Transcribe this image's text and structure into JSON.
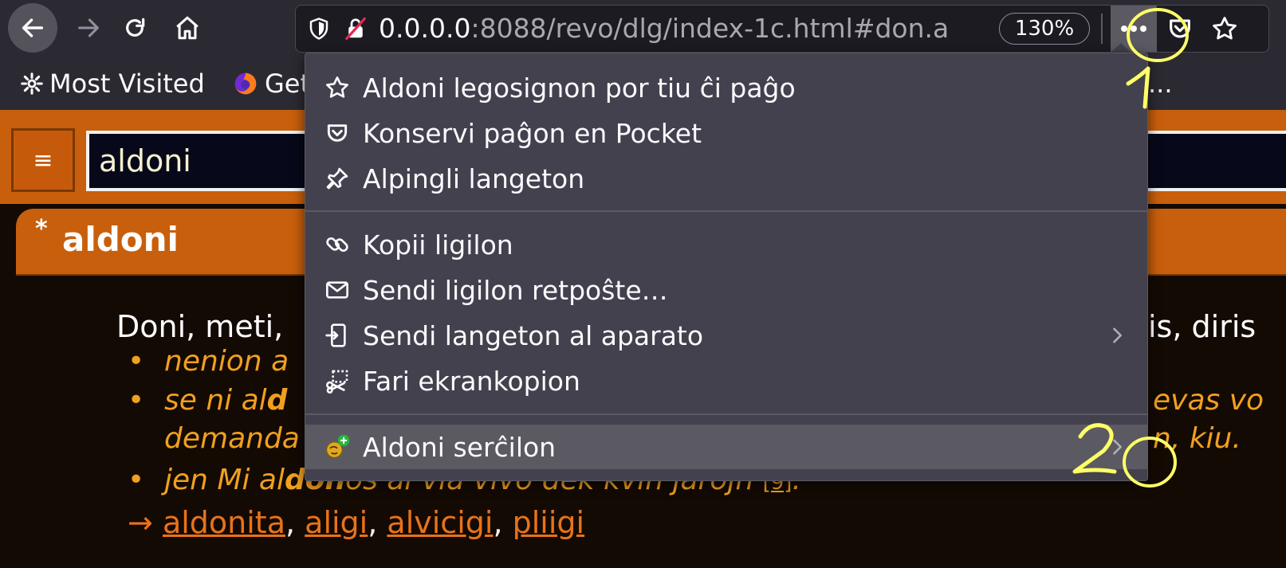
{
  "browser": {
    "url_host": "0.0.0.0",
    "url_rest": ":8088/revo/dlg/index-1c.html#don.a",
    "zoom": "130%",
    "bookmarks": [
      {
        "label": "Most Visited",
        "icon": "gear-icon"
      },
      {
        "label": "Get",
        "icon": "firefox-icon"
      }
    ],
    "bookmark_overflow": "..."
  },
  "page": {
    "search_value": "aldoni",
    "menu_icon": "≡",
    "word_star": "*",
    "word_title": "aldoni",
    "definition_start": "Doni, meti,",
    "definition_end": "is, diris",
    "examples": [
      {
        "text": "nenion a"
      },
      {
        "text": "se ni al",
        "bold": "d",
        "right": "evas vo"
      },
      {
        "text": "demanda",
        "right": "n, kiu."
      },
      {
        "text": "jen Mi al",
        "bold": "don",
        "rest": "os al via vivo dek kvin jarojn",
        "ref": "[9]",
        "end": "."
      }
    ],
    "see_also_arrow": "→",
    "see_also": [
      "aldonita",
      "aligi",
      "alvicigi",
      "pliigi"
    ]
  },
  "menu": {
    "items": [
      {
        "label": "Aldoni legosignon por tiu ĉi paĝo",
        "icon": "star-icon"
      },
      {
        "label": "Konservi paĝon en Pocket",
        "icon": "pocket-icon"
      },
      {
        "label": "Alpingli langeton",
        "icon": "pin-icon"
      },
      {
        "label": "Kopii ligilon",
        "icon": "link-icon"
      },
      {
        "label": "Sendi ligilon retpoŝte…",
        "icon": "mail-icon"
      },
      {
        "label": "Sendi langeton al aparato",
        "icon": "send-device-icon",
        "submenu": true
      },
      {
        "label": "Fari ekrankopion",
        "icon": "screenshot-icon"
      },
      {
        "label": "Aldoni serĉilon",
        "icon": "add-search-engine-icon",
        "submenu": true,
        "highlighted": true
      }
    ]
  },
  "annotations": {
    "label_1": "1",
    "label_2": "2",
    "color": "#ffff66"
  }
}
